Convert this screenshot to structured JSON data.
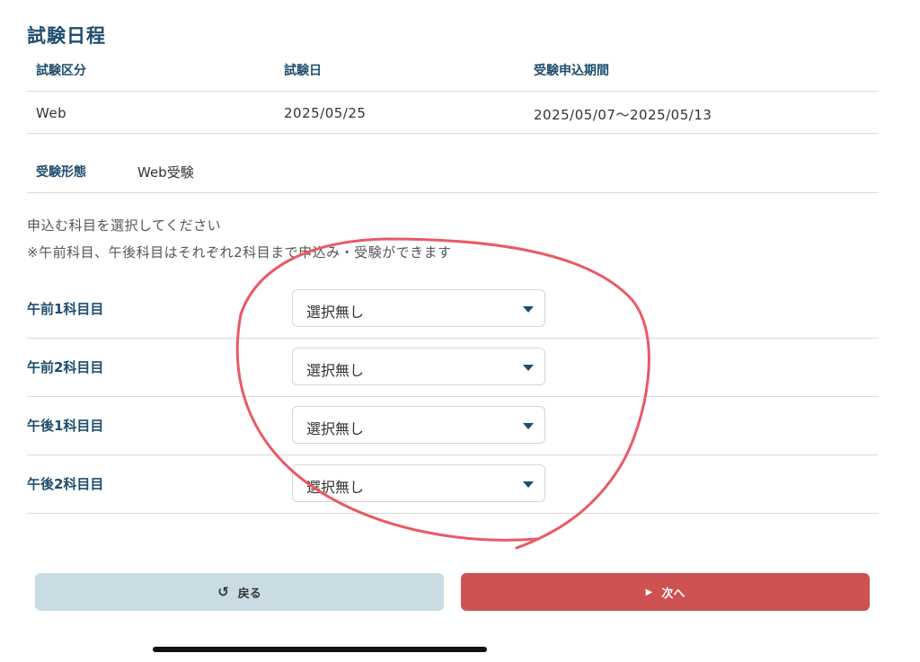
{
  "section_title": "試験日程",
  "schedule": {
    "headers": [
      "試験区分",
      "試験日",
      "受験申込期間"
    ],
    "row": [
      "Web",
      "2025/05/25",
      "2025/05/07〜2025/05/13"
    ]
  },
  "exam_format": {
    "label": "受験形態",
    "value": "Web受験"
  },
  "instructions": {
    "line1": "申込む科目を選択してください",
    "line2": "※午前科目、午後科目はそれぞれ2科目まで申込み・受験ができます"
  },
  "subjects": [
    {
      "label": "午前1科目目",
      "selected": "選択無し"
    },
    {
      "label": "午前2科目目",
      "selected": "選択無し"
    },
    {
      "label": "午後1科目目",
      "selected": "選択無し"
    },
    {
      "label": "午後2科目目",
      "selected": "選択無し"
    }
  ],
  "buttons": {
    "back_label": "戻る",
    "next_label": "次へ",
    "back_icon": "undo-icon",
    "next_icon": "caret-right-icon"
  },
  "colors": {
    "heading": "#1f4d6e",
    "back_button": "#c9dbe3",
    "next_button": "#cd5251",
    "annotation": "#e85a66"
  }
}
